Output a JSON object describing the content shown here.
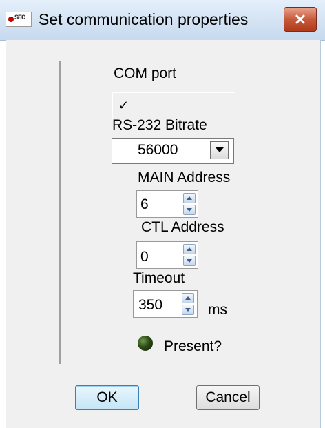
{
  "window": {
    "title": "Set communication properties",
    "icon": "app-logo-icon",
    "icon_text": "SEC",
    "close_icon": "close-icon"
  },
  "form": {
    "com_port": {
      "label": "COM port",
      "value": "✓"
    },
    "bitrate": {
      "label": "RS-232 Bitrate",
      "value": "56000",
      "dropdown_icon": "chevron-down-icon"
    },
    "main_address": {
      "label": "MAIN Address",
      "value": "6"
    },
    "ctl_address": {
      "label": "CTL Address",
      "value": "0"
    },
    "timeout": {
      "label": "Timeout",
      "value": "350",
      "unit": "ms"
    },
    "present": {
      "label": "Present?",
      "indicator_color": "#2d4a17"
    }
  },
  "buttons": {
    "ok": "OK",
    "cancel": "Cancel"
  },
  "colors": {
    "close_button": "#c75a3b",
    "titlebar": "#c6d9ee",
    "dialog_bg": "#f0f0f0"
  }
}
